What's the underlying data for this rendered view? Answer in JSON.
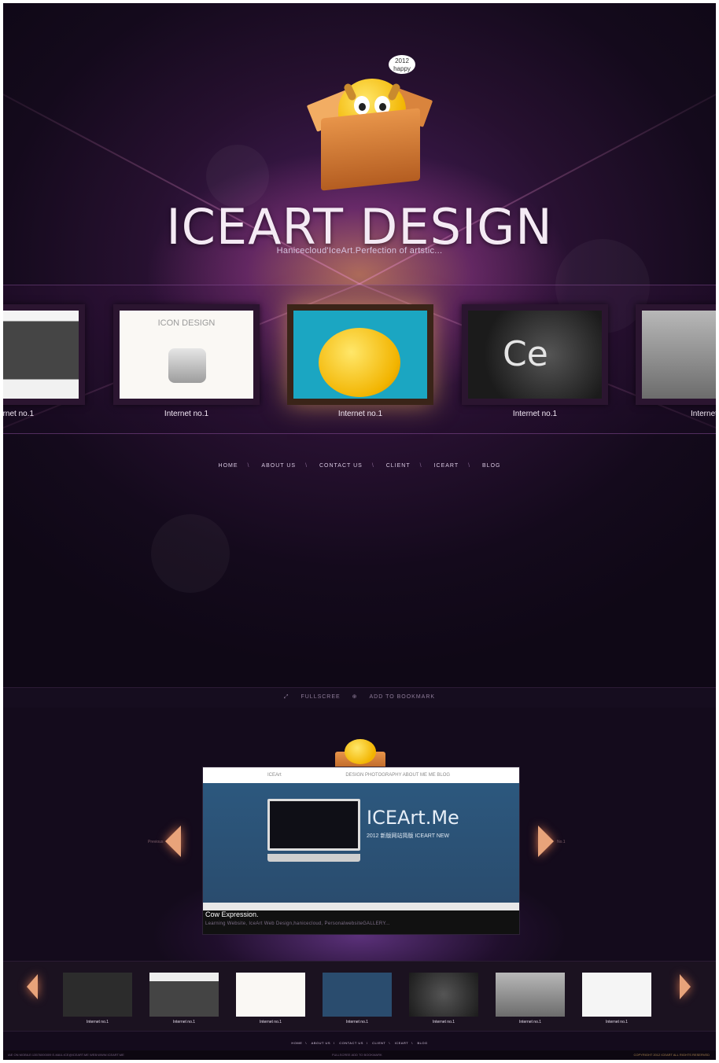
{
  "brand": {
    "title": "ICEART DESIGN",
    "subtitle": "Hanicecloud'IceArt.Perfection of artstic...",
    "bubble": "2012 happy"
  },
  "carousel": [
    {
      "label": "Internet no.1",
      "thumb": "website"
    },
    {
      "label": "Internet no.1",
      "thumb": "icon-design",
      "thumb_text": "ICON DESIGN"
    },
    {
      "label": "Internet no.1",
      "thumb": "cow-mascot"
    },
    {
      "label": "Internet no.1",
      "thumb": "ice-logo"
    },
    {
      "label": "Internet",
      "thumb": "cow-photo"
    }
  ],
  "nav": [
    "HOME",
    "ABOUT US",
    "CONTACT US",
    "CLIENT",
    "ICEART",
    "BLOG"
  ],
  "toolbar": {
    "fullscreen": "FULLSCREE",
    "bookmark": "ADD TO BOOKMARK"
  },
  "feature": {
    "header_brand": "ICEArt",
    "header_links": "DESIGN    PHOTOGRAPHY    ABOUT ME    ME BLOG",
    "brand": "ICEArt.Me",
    "brand_sub": "2012 新版网站简版 ICEART NEW",
    "caption": "Cow Expression.",
    "caption_sub": "Learning Website, IceArt Web Design,hanicecloud, PersonalwebsiteGALLERY...",
    "prev_label": "Previous",
    "next_label": "No.1"
  },
  "bottom_strip": [
    {
      "label": "Internet no.1",
      "thumb": "dark-site"
    },
    {
      "label": "Internet no.1",
      "thumb": "iceart-site"
    },
    {
      "label": "Internet no.1",
      "thumb": "icon-design"
    },
    {
      "label": "Internet no.1",
      "thumb": "blue-site"
    },
    {
      "label": "Internet no.1",
      "thumb": "ice-logo"
    },
    {
      "label": "Internet no.1",
      "thumb": "cow-photo"
    },
    {
      "label": "Internet no.1",
      "thumb": "light-site"
    }
  ],
  "bottom_nav": [
    "HOME",
    "ABOUT US",
    "CONTACT US",
    "CLIENT",
    "ICEART",
    "BLOG"
  ],
  "footer": {
    "left": "IAE  ON   MOBILE:13576000009   E-MAIL:ICE@ICEART.ME   WEB:WWW.ICEART.ME",
    "middle": "FULLSCREE   ADD TO BOOKMARK",
    "right": "COPYRIGHT 2012 ICEART ALL RIGHTS RESERVED"
  },
  "colors": {
    "accent": "#e8a37a",
    "background": "#140b1c",
    "highlight": "#f2b400"
  }
}
